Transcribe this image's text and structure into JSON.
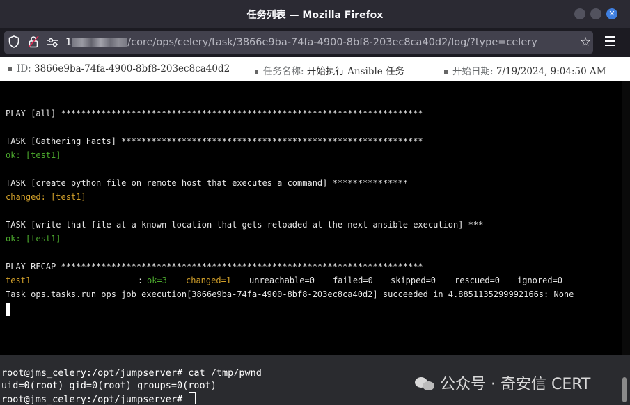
{
  "window": {
    "title": "任务列表 — Mozilla Firefox"
  },
  "navbar": {
    "url_prefix": "1",
    "url_path": "/core/ops/celery/task/3866e9ba-74fa-4900-8bf8-203ec8ca40d2/log/?type=celery",
    "icons": [
      "shield-icon",
      "lock-icon",
      "permissions-icon",
      "star-icon",
      "menu-icon"
    ]
  },
  "info": {
    "id_label": "ID:",
    "id_value": "3866e9ba-74fa-4900-8bf8-203ec8ca40d2",
    "task_label": "任务名称:",
    "task_value": "开始执行 Ansible 任务",
    "date_label": "开始日期:",
    "date_value": "7/19/2024, 9:04:50 AM"
  },
  "log": {
    "play_all": "PLAY [all] ************************************************************************",
    "task_facts": "TASK [Gathering Facts] ************************************************************",
    "ok_1": "ok: [test1]",
    "task_create": "TASK [create python file on remote host that executes a command] ***************",
    "changed_1": "changed: [test1]",
    "task_write": "TASK [write that file at a known location that gets reloaded at the next ansible execution] ***",
    "ok_2": "ok: [test1]",
    "play_recap": "PLAY RECAP ************************************************************************",
    "recap": {
      "host": "test1",
      "colon": ":",
      "ok": "ok=3",
      "changed": "changed=1",
      "unreachable": "unreachable=0",
      "failed": "failed=0",
      "skipped": "skipped=0",
      "rescued": "rescued=0",
      "ignored": "ignored=0"
    },
    "result": "Task ops.tasks.run_ops_job_execution[3866e9ba-74fa-4900-8bf8-203ec8ca40d2] succeeded in 4.8851135299992166s: None"
  },
  "shell": {
    "line1": "root@jms_celery:/opt/jumpserver# cat /tmp/pwnd",
    "line2": "uid=0(root) gid=0(root) groups=0(root)",
    "line3": "root@jms_celery:/opt/jumpserver# "
  },
  "watermark": {
    "text": "公众号 · 奇安信 CERT"
  },
  "colors": {
    "ok": "#4dab2e",
    "changed": "#d2a02a",
    "titlebar": "#2b2a33",
    "close": "#3f7fe0"
  }
}
